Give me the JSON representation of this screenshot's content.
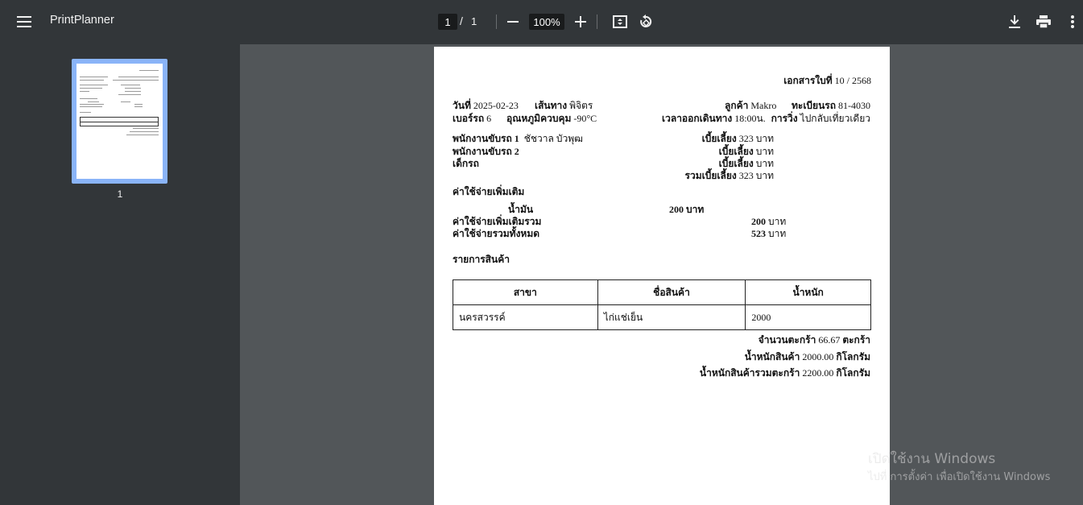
{
  "toolbar": {
    "title": "PrintPlanner",
    "current_page": "1",
    "page_separator": "/",
    "total_pages": "1",
    "zoom": "100%",
    "icons": [
      "menu-icon",
      "zoom-out-icon",
      "zoom-in-icon",
      "fit-page-icon",
      "rotate-icon",
      "download-icon",
      "print-icon",
      "more-vert-icon"
    ]
  },
  "sidebar": {
    "thumbnail_label": "1"
  },
  "document": {
    "doc_no_label": "เอกสารใบที่",
    "doc_no": "10 / 2568",
    "date_label": "วันที่",
    "date": "2025-02-23",
    "route_label": "เส้นทาง",
    "route": "พิจิตร",
    "customer_label": "ลูกค้า",
    "customer": "Makro",
    "plate_label": "ทะเบียนรถ",
    "plate": "81-4030",
    "truck_no_label": "เบอร์รถ",
    "truck_no": "6",
    "temp_label": "อุณหภูมิควบคุม",
    "temp": "-90°C",
    "depart_label": "เวลาออกเดินทาง",
    "depart": "18:00น.",
    "trip_label": "การวิ่ง",
    "trip": "ไปกลับเที่ยวเดียว",
    "driver1_label": "พนักงานขับรถ 1",
    "driver1": "ชัชวาล บัวพุฒ",
    "driver2_label": "พนักงานขับรถ 2",
    "driver2": "",
    "assistant_label": "เด็กรถ",
    "allowance_label": "เบี้ยเลี้ยง",
    "allowance1": "323",
    "allowance2": "",
    "allowance3": "",
    "allowance_total_label": "รวมเบี้ยเลี้ยง",
    "allowance_total": "323",
    "baht": "บาท",
    "extra_title": "ค่าใช้จ่ายเพิ่มเติม",
    "fuel_label": "น้ำมัน",
    "fuel_amount": "200",
    "extra_total_label": "ค่าใช้จ่ายเพิ่มเติมรวม",
    "extra_total": "200",
    "grand_total_label": "ค่าใช้จ่ายรวมทั้งหมด",
    "grand_total": "523",
    "items_title": "รายการสินค้า",
    "table_headers": [
      "สาขา",
      "ชื่อสินค้า",
      "น้ำหนัก"
    ],
    "table_rows": [
      [
        "นครสวรรค์",
        "ไก่แช่เย็น",
        "2000"
      ]
    ],
    "crates_label": "จำนวนตะกร้า",
    "crates": "66.67",
    "crates_unit": "ตะกร้า",
    "product_weight_label": "น้ำหนักสินค้า",
    "product_weight": "2000.00",
    "kg": "กิโลกรัม",
    "total_weight_label": "น้ำหนักสินค้ารวมตะกร้า",
    "total_weight": "2200.00"
  },
  "watermark": {
    "line1": "เปิดใช้งาน Windows",
    "line2": "ไปที่ การตั้งค่า เพื่อเปิดใช้งาน Windows"
  }
}
